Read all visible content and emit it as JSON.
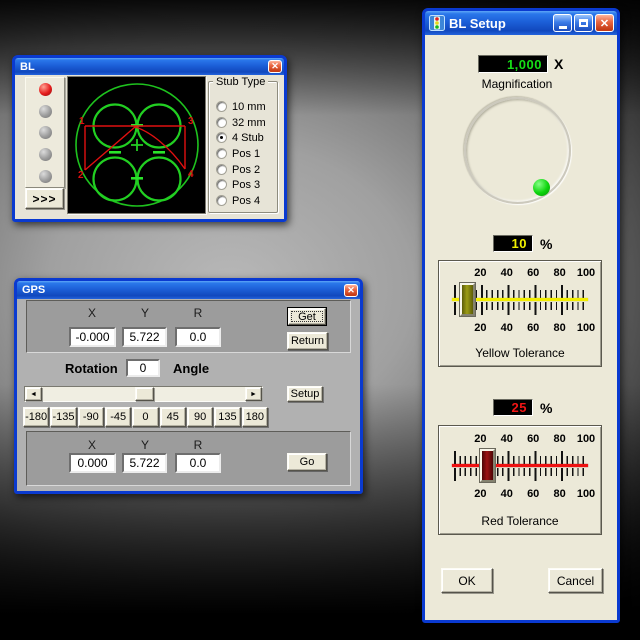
{
  "icons": {
    "close": "✕",
    "arrow_left": "◄",
    "arrow_right": "►"
  },
  "bl_window": {
    "title": "BL",
    "expand_button": ">>>",
    "leds": [
      "red",
      "gray",
      "gray",
      "gray",
      "gray"
    ],
    "diagram": {
      "point_labels": {
        "p1": "1",
        "p2": "2",
        "p3": "3",
        "p4": "4"
      }
    },
    "stub_type": {
      "label": "Stub Type",
      "selected": "4 Stub",
      "options": [
        {
          "label": "10 mm",
          "selected": false
        },
        {
          "label": "32 mm",
          "selected": false
        },
        {
          "label": "4 Stub",
          "selected": true
        },
        {
          "label": "Pos 1",
          "selected": false
        },
        {
          "label": "Pos 2",
          "selected": false
        },
        {
          "label": "Pos 3",
          "selected": false
        },
        {
          "label": "Pos 4",
          "selected": false
        }
      ]
    }
  },
  "gps_window": {
    "title": "GPS",
    "current": {
      "x_label": "X",
      "y_label": "Y",
      "r_label": "R",
      "x": "-0.000",
      "y": "5.722",
      "r": "0.0"
    },
    "buttons": {
      "get": "Get",
      "return": "Return",
      "setup": "Setup",
      "go": "Go"
    },
    "rotation": {
      "label": "Rotation",
      "value": "0",
      "unit_label": "Angle"
    },
    "angle_presets": [
      "-180",
      "-135",
      "-90",
      "-45",
      "0",
      "45",
      "90",
      "135",
      "180"
    ],
    "target": {
      "x_label": "X",
      "y_label": "Y",
      "r_label": "R",
      "x": "0.000",
      "y": "5.722",
      "r": "0.0"
    }
  },
  "setup_window": {
    "title": "BL Setup",
    "magnification": {
      "value": "1,000",
      "unit": "X",
      "label": "Magnification",
      "color": "#16df16"
    },
    "yellow_tolerance": {
      "value": "10",
      "unit": "%",
      "label": "Yellow Tolerance",
      "percent": 10,
      "color": "#f2f200"
    },
    "red_tolerance": {
      "value": "25",
      "unit": "%",
      "label": "Red Tolerance",
      "percent": 25,
      "color": "#f21515"
    },
    "scale_labels": [
      "20",
      "40",
      "60",
      "80",
      "100"
    ],
    "buttons": {
      "ok": "OK",
      "cancel": "Cancel"
    }
  }
}
